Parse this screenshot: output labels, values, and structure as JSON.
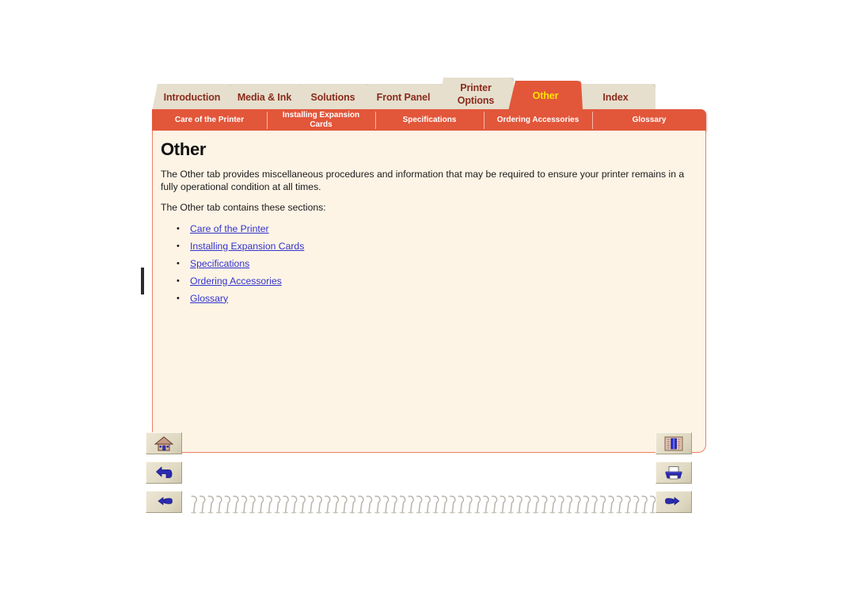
{
  "document": {
    "title": "Other",
    "change_bar_present": true
  },
  "main_tabs": [
    {
      "label": "Introduction",
      "active": false,
      "two_line": false,
      "icon": "folder-tab-icon"
    },
    {
      "label": "Media & Ink",
      "active": false,
      "two_line": false,
      "icon": "folder-tab-icon"
    },
    {
      "label": "Solutions",
      "active": false,
      "two_line": false,
      "icon": "folder-tab-icon"
    },
    {
      "label": "Front Panel",
      "active": false,
      "two_line": false,
      "icon": "folder-tab-icon"
    },
    {
      "label": "Printer Options",
      "line1": "Printer",
      "line2": "Options",
      "active": false,
      "two_line": true,
      "icon": "folder-tab-icon"
    },
    {
      "label": "Other",
      "active": true,
      "two_line": false,
      "icon": "folder-tab-icon"
    },
    {
      "label": "Index",
      "active": false,
      "two_line": false,
      "icon": "folder-tab-icon"
    }
  ],
  "sub_tabs": [
    {
      "label": "Care of the Printer"
    },
    {
      "label": "Installing Expansion Cards",
      "line1": "Installing Expansion",
      "line2": "Cards"
    },
    {
      "label": "Specifications"
    },
    {
      "label": "Ordering Accessories"
    },
    {
      "label": "Glossary"
    }
  ],
  "content": {
    "heading": "Other",
    "paragraph1": "The Other tab provides miscellaneous procedures and information that may be required to ensure your printer remains in a fully operational condition at all times.",
    "paragraph2": "The Other tab contains these sections:",
    "links": [
      "Care of the Printer",
      "Installing Expansion Cards",
      "Specifications",
      "Ordering Accessories",
      "Glossary"
    ]
  },
  "left_buttons": [
    {
      "name": "home-button",
      "icon": "home-icon",
      "tooltip": "Home"
    },
    {
      "name": "back-button",
      "icon": "back-arrow-icon",
      "tooltip": "Back"
    },
    {
      "name": "previous-page-button",
      "icon": "pointing-hand-left-icon",
      "tooltip": "Previous page"
    }
  ],
  "right_buttons": [
    {
      "name": "bookshelf-button",
      "icon": "bookshelf-icon",
      "tooltip": "Bookshelf"
    },
    {
      "name": "print-button",
      "icon": "printer-icon",
      "tooltip": "Print"
    },
    {
      "name": "next-page-button",
      "icon": "pointing-hand-right-icon",
      "tooltip": "Next page"
    }
  ],
  "colors": {
    "accent_orange": "#e2563a",
    "active_tab_text": "#ffe200",
    "inactive_tab_bg": "#e6dfcd",
    "inactive_tab_text": "#8a2b1c",
    "page_bg": "#fdf4e6",
    "page_border": "#ef7f62",
    "link": "#3333cc",
    "body_text": "#1a1a1a",
    "button_face": "#ece6d4",
    "page_background": "#ffffff"
  }
}
